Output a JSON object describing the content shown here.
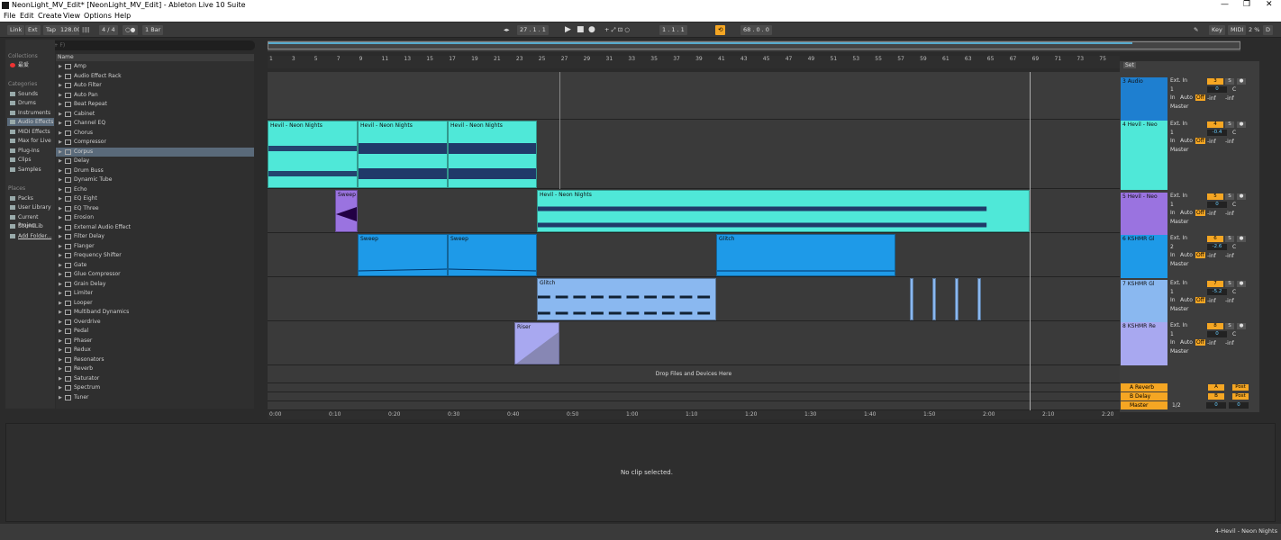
{
  "window": {
    "title": "NeonLight_MV_Edit*  [NeonLight_MV_Edit] - Ableton Live 10 Suite",
    "min": "—",
    "max": "❐",
    "close": "✕"
  },
  "menu": [
    "File",
    "Edit",
    "Create",
    "View",
    "Options",
    "Help"
  ],
  "toolbar": {
    "link": "Link",
    "ext": "Ext",
    "tap": "Tap",
    "tempo": "128.00",
    "sig": "4 / 4",
    "metro": "○●",
    "quant": "1 Bar",
    "pos": "27 .  1 .  1",
    "loop_start": "1 .  1 .  1",
    "loop_len": "68 .  0 .  0",
    "key": "Key",
    "midi": "MIDI",
    "cpu": "2 %",
    "d": "D"
  },
  "search": {
    "placeholder": "Search (Ctrl + F)"
  },
  "sidebar": {
    "collections": "Collections",
    "fav": "最爱",
    "categories": "Categories",
    "cat_items": [
      "Sounds",
      "Drums",
      "Instruments",
      "Audio Effects",
      "MIDI Effects",
      "Max for Live",
      "Plug-Ins",
      "Clips",
      "Samples"
    ],
    "places": "Places",
    "place_items": [
      "Packs",
      "User Library",
      "Current Projec",
      "SoundLib",
      "Add Folder..."
    ]
  },
  "browser": {
    "header": "Name",
    "items": [
      "Amp",
      "Audio Effect Rack",
      "Auto Filter",
      "Auto Pan",
      "Beat Repeat",
      "Cabinet",
      "Channel EQ",
      "Chorus",
      "Compressor",
      "Corpus",
      "Delay",
      "Drum Buss",
      "Dynamic Tube",
      "Echo",
      "EQ Eight",
      "EQ Three",
      "Erosion",
      "External Audio Effect",
      "Filter Delay",
      "Flanger",
      "Frequency Shifter",
      "Gate",
      "Glue Compressor",
      "Grain Delay",
      "Limiter",
      "Looper",
      "Multiband Dynamics",
      "Overdrive",
      "Pedal",
      "Phaser",
      "Redux",
      "Resonators",
      "Reverb",
      "Saturator",
      "Spectrum",
      "Tuner"
    ]
  },
  "ruler": [
    "1",
    "3",
    "5",
    "7",
    "9",
    "11",
    "13",
    "15",
    "17",
    "19",
    "21",
    "23",
    "25",
    "27",
    "29",
    "31",
    "33",
    "35",
    "37",
    "39",
    "41",
    "43",
    "45",
    "47",
    "49",
    "51",
    "53",
    "55",
    "57",
    "59",
    "61",
    "63",
    "65",
    "67",
    "69",
    "71",
    "73",
    "75"
  ],
  "time_ruler": [
    "0:00",
    "0:10",
    "0:20",
    "0:30",
    "0:40",
    "0:50",
    "1:00",
    "1:10",
    "1:20",
    "1:30",
    "1:40",
    "1:50",
    "2:00",
    "2:10",
    "2:20"
  ],
  "clips": {
    "hevil1": "Hevil - Neon Nights",
    "hevil2": "Hevil - Neon Nights",
    "hevil3": "Hevil - Neon Nights",
    "hevil4": "Hevil - Neon Nights",
    "sweep1": "Sweep",
    "sweep2": "Sweep",
    "sweep3": "Sweep",
    "glitch1": "Glitch",
    "glitch2": "Glitch",
    "riser": "Riser"
  },
  "drop_text": "Drop Files and Devices Here",
  "set_label": "Set",
  "tracks": [
    {
      "name": "3 Audio",
      "input": "Ext. In",
      "ch": "1",
      "num": "3",
      "vol": "0",
      "pan": "C",
      "color": "#1e7fd0"
    },
    {
      "name": "4 Hevil - Neo",
      "input": "Ext. In",
      "ch": "1",
      "num": "4",
      "vol": "-0.4",
      "pan": "C",
      "color": "#4fe8d8"
    },
    {
      "name": "5 Hevil - Neo",
      "input": "Ext. In",
      "ch": "1",
      "num": "5",
      "vol": "0",
      "pan": "C",
      "color": "#9a73e0"
    },
    {
      "name": "6 KSHMR Gl",
      "input": "Ext. In",
      "ch": "2",
      "num": "6",
      "vol": "-2.6",
      "pan": "C",
      "color": "#1e9ae8"
    },
    {
      "name": "7 KSHMR Gl",
      "input": "Ext. In",
      "ch": "1",
      "num": "7",
      "vol": "-5.2",
      "pan": "C",
      "color": "#8ab8f0"
    },
    {
      "name": "8 KSHMR Re",
      "input": "Ext. In",
      "ch": "1",
      "num": "8",
      "vol": "0",
      "pan": "C",
      "color": "#a8a8f0"
    }
  ],
  "mixer_common": {
    "in": "In",
    "auto": "Auto",
    "off": "Off",
    "inf": "-inf",
    "master": "Master",
    "s": "S"
  },
  "returns": [
    {
      "name": "A Reverb",
      "letter": "A"
    },
    {
      "name": "B Delay",
      "letter": "B"
    }
  ],
  "master": {
    "name": "Master",
    "route": "1/2",
    "vol": "0",
    "pan": "0",
    "post": "Post"
  },
  "bottom": {
    "msg": "No clip selected."
  },
  "status": {
    "right": "4-Hevil - Neon Nights"
  }
}
